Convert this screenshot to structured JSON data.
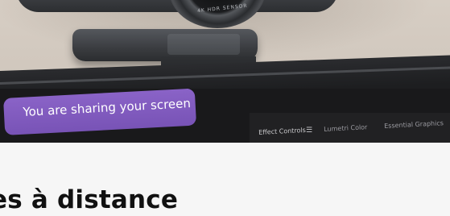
{
  "hero": {
    "sensor_label": "4K HDR SENSOR",
    "share_banner": "You are sharing your screen",
    "panel_tabs": [
      "Effect Controls",
      "Lumetri Color",
      "Essential Graphics"
    ],
    "menu_icon": "menu-icon"
  },
  "section": {
    "heading": "es à distance"
  }
}
